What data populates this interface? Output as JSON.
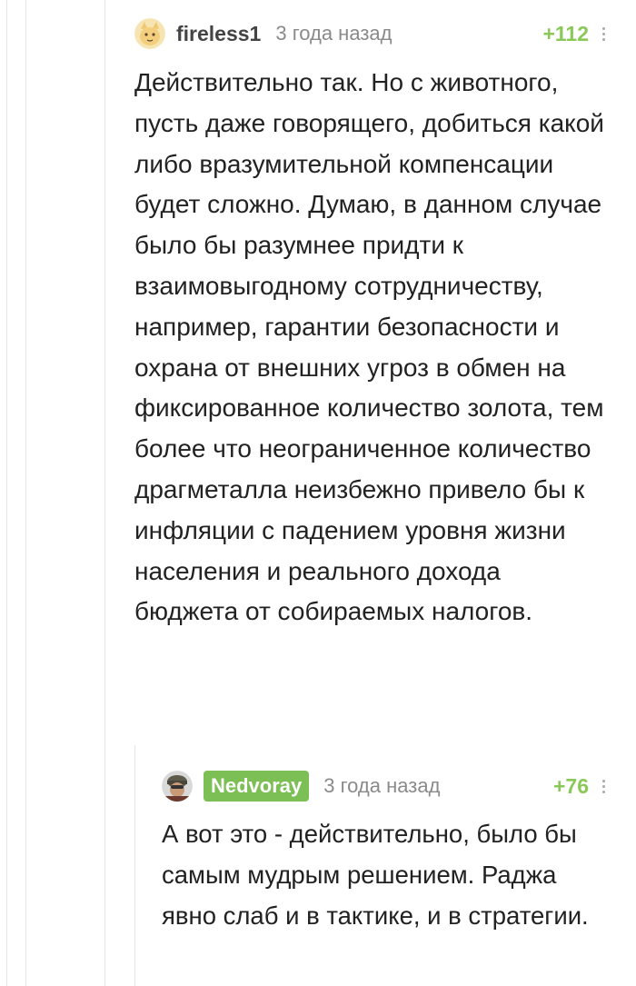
{
  "comments": [
    {
      "author": "fireless1",
      "time": "3 года назад",
      "rating": "+112",
      "avatar_icon": "cat-avatar-icon",
      "body": "Действительно так. Но с животного, пусть даже говорящего, добиться какой либо вразумительной компенсации будет сложно. Думаю, в данном случае было бы разумнее придти к взаимовыгодному сотрудничеству, например, гарантии безопасности и охрана от внешних угроз в обмен на фиксированное количество золота, тем более что неограниченное количество драгметалла неизбежно привело бы к инфляции с падением уровня жизни населения и реального дохода бюджета от собираемых налогов."
    },
    {
      "author": "Nedvoray",
      "time": "3 года назад",
      "rating": "+76",
      "avatar_icon": "soldier-avatar-icon",
      "author_badge_color": "#7cbf55",
      "body": "А вот это - действительно, было бы самым мудрым решением. Раджа явно слаб и в тактике, и в стратегии."
    }
  ],
  "colors": {
    "rating": "#8ac858",
    "time": "#8a8a8a",
    "thread_line": "#e6e6e6"
  }
}
